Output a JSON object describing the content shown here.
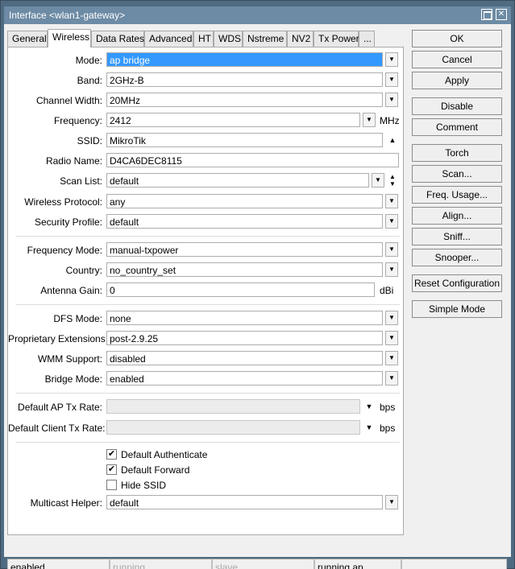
{
  "window": {
    "title": "Interface <wlan1-gateway>"
  },
  "tabs": [
    "General",
    "Wireless",
    "Data Rates",
    "Advanced",
    "HT",
    "WDS",
    "Nstreme",
    "NV2",
    "Tx Power",
    "..."
  ],
  "fields": {
    "mode": {
      "label": "Mode:",
      "value": "ap bridge"
    },
    "band": {
      "label": "Band:",
      "value": "2GHz-B"
    },
    "channel_width": {
      "label": "Channel Width:",
      "value": "20MHz"
    },
    "frequency": {
      "label": "Frequency:",
      "value": "2412",
      "unit": "MHz"
    },
    "ssid": {
      "label": "SSID:",
      "value": "MikroTik"
    },
    "radio_name": {
      "label": "Radio Name:",
      "value": "D4CA6DEC8115"
    },
    "scan_list": {
      "label": "Scan List:",
      "value": "default"
    },
    "wireless_protocol": {
      "label": "Wireless Protocol:",
      "value": "any"
    },
    "security_profile": {
      "label": "Security Profile:",
      "value": "default"
    },
    "frequency_mode": {
      "label": "Frequency Mode:",
      "value": "manual-txpower"
    },
    "country": {
      "label": "Country:",
      "value": "no_country_set"
    },
    "antenna_gain": {
      "label": "Antenna Gain:",
      "value": "0",
      "unit": "dBi"
    },
    "dfs_mode": {
      "label": "DFS Mode:",
      "value": "none"
    },
    "proprietary_extensions": {
      "label": "Proprietary Extensions:",
      "value": "post-2.9.25"
    },
    "wmm_support": {
      "label": "WMM Support:",
      "value": "disabled"
    },
    "bridge_mode": {
      "label": "Bridge Mode:",
      "value": "enabled"
    },
    "default_ap_tx_rate": {
      "label": "Default AP Tx Rate:",
      "value": "",
      "unit": "bps"
    },
    "default_client_tx_rate": {
      "label": "Default Client Tx Rate:",
      "value": "",
      "unit": "bps"
    },
    "multicast_helper": {
      "label": "Multicast Helper:",
      "value": "default"
    }
  },
  "checkboxes": [
    {
      "label": "Default Authenticate",
      "checked": true
    },
    {
      "label": "Default Forward",
      "checked": true
    },
    {
      "label": "Hide SSID",
      "checked": false
    }
  ],
  "buttons": [
    "OK",
    "Cancel",
    "Apply",
    "Disable",
    "Comment",
    "Torch",
    "Scan...",
    "Freq. Usage...",
    "Align...",
    "Sniff...",
    "Snooper...",
    "Reset Configuration",
    "Simple Mode"
  ],
  "status_bar": [
    "enabled",
    "running",
    "slave",
    "running ap",
    ""
  ],
  "colors": {
    "title_bar": "#6d8ba5",
    "selection": "#3399ff",
    "frame": "#4f6b82"
  }
}
